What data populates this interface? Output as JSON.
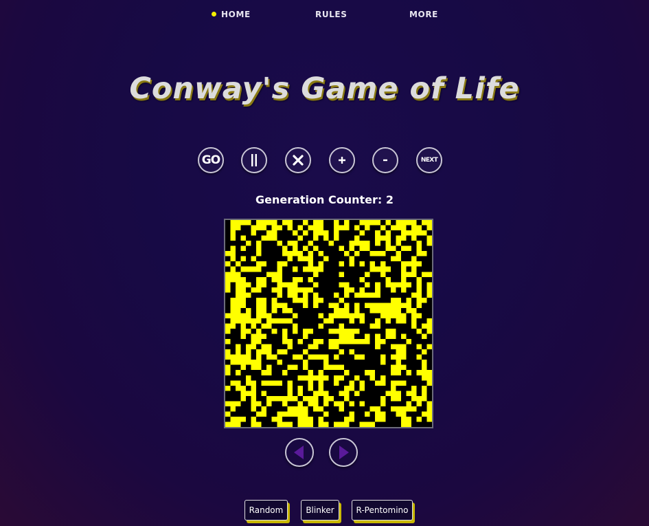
{
  "nav": {
    "items": [
      {
        "label": "HOME",
        "active": true
      },
      {
        "label": "RULES",
        "active": false
      },
      {
        "label": "MORE",
        "active": false
      }
    ],
    "active_dot_color": "#f5f000"
  },
  "title": "Conway's Game of Life",
  "controls": {
    "go_label": "GO",
    "next_label": "NEXT",
    "buttons": [
      "go",
      "pause",
      "clear",
      "speed-up",
      "slow-down",
      "next"
    ]
  },
  "counter": {
    "label": "Generation Counter:",
    "value": 2,
    "text": "Generation Counter: 2"
  },
  "board": {
    "alive_color": "#ffff00",
    "dead_color": "#000000",
    "columns": 40,
    "rows": 40,
    "grid": [
      "0111101111011001011001010011110101111011",
      "0110011101101010111001110101001011101101",
      "0100010011000101011101000010010100111110",
      "0101000111000010010101000100011101101001",
      "0000101000101100100010001111010101000101",
      "0101001000010101010000101011000110110100",
      "1100001000011110101000010100111001000110",
      "0101010000001011100100001000000011001000",
      "1010001100110000101000101010101000111100",
      "0101111000100101111000000000111100101000",
      "1110000011100000010000100001001000111011",
      "1111001101100110100000000010000100100100",
      "1011101100111100010000110001010111110101",
      "1011011001101111100000011010010010100101",
      "0011100000101101010001010111110000001101",
      "0111001101000111011000100000000011010110",
      "0111001101110001010011010101111111110100",
      "0110101101011000000001110100111111011000",
      "1111101110000100001011111110001111101100",
      "0111111011111000000110001010010101101001",
      "1101010110000100001000100000110000001011",
      "1001101001010101100011111100000110000101",
      "0001011100010001000000111001010110100010",
      "1000011000011010011011111111011000010000",
      "0010110110001000110011000000010011100101",
      "1010101110110001000000101000000001100010",
      "1111101011000110111101000110001011100100",
      "0111111000100001000100000000001001000010",
      "1001011010001101000111100000000011100010",
      "1010000110010000101000010001100011010111",
      "0000100000000011111101100100101000000011",
      "0110110111101000101001001010011011100001",
      "1011010000001010101000011010000010001010",
      "0001110100001010011100110100000111011010",
      "0001010011111101110110010000001011001110",
      "1110011010010010110101101010001000010101",
      "0100010100001111011000100000110011111001",
      "1000001100111111000100001001011001100011",
      "0111010001100011101000011000011000110101",
      "1110011000111011101101110011100000110000"
    ]
  },
  "history": {
    "prev_color": "#5a1a9a",
    "next_color": "#5a1a9a"
  },
  "presets": [
    "Random",
    "Blinker",
    "R-Pentomino"
  ],
  "colors": {
    "accent_yellow": "#f5f000",
    "title_shadow": "#8a7a14",
    "background": "#1a0b4a"
  }
}
